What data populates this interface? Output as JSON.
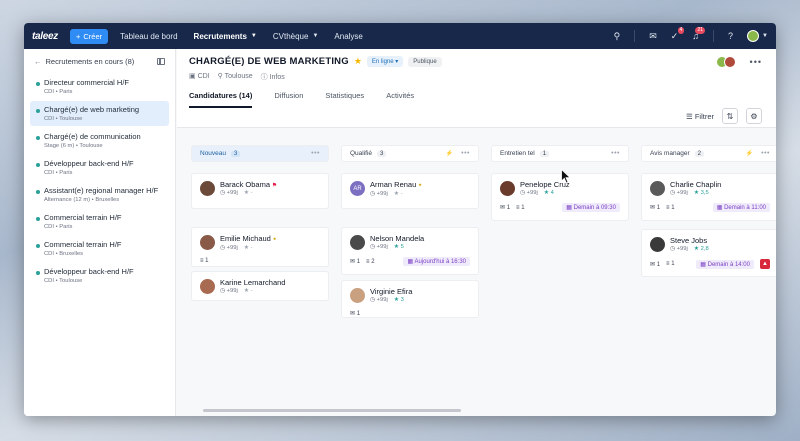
{
  "nav": {
    "logo": "taleez",
    "create": "Créer",
    "items": [
      {
        "label": "Tableau de bord",
        "active": false,
        "caret": false
      },
      {
        "label": "Recrutements",
        "active": true,
        "caret": true
      },
      {
        "label": "CVthèque",
        "active": false,
        "caret": true
      },
      {
        "label": "Analyse",
        "active": false,
        "caret": false
      }
    ],
    "badges": {
      "tasks": "4",
      "notifications": "21"
    }
  },
  "sidebar": {
    "title": "Recrutements en cours (8)",
    "jobs": [
      {
        "title": "Directeur commercial H/F",
        "meta": "CDI • Paris",
        "active": false
      },
      {
        "title": "Chargé(e) de web marketing",
        "meta": "CDI • Toulouse",
        "active": true
      },
      {
        "title": "Chargé(e) de communication",
        "meta": "Stage (6 m) • Toulouse",
        "active": false
      },
      {
        "title": "Développeur back-end H/F",
        "meta": "CDI • Paris",
        "active": false
      },
      {
        "title": "Assistant(e) regional manager H/F",
        "meta": "Alternance (12 m) • Bruxelles",
        "active": false
      },
      {
        "title": "Commercial terrain H/F",
        "meta": "CDI • Paris",
        "active": false
      },
      {
        "title": "Commercial terrain H/F",
        "meta": "CDI • Bruxelles",
        "active": false
      },
      {
        "title": "Développeur back-end H/F",
        "meta": "CDI • Toulouse",
        "active": false
      }
    ]
  },
  "header": {
    "title": "CHARGÉ(E) DE WEB MARKETING",
    "status": "En ligne",
    "visibility": "Publique",
    "contract": "CDI",
    "location": "Toulouse",
    "info": "Infos",
    "tabs": [
      "Candidatures (14)",
      "Diffusion",
      "Statistiques",
      "Activités"
    ],
    "filter": "Filtrer"
  },
  "columns": [
    {
      "name": "Nouveau",
      "count": "3",
      "highlight": true,
      "bolt": false,
      "cards": [
        {
          "name": "Barack Obama",
          "age": "+99j",
          "rating": "-",
          "rated": false,
          "flag": true,
          "medal": false,
          "photo": "#6b4a3a",
          "initials": "",
          "foot": {
            "mail": "",
            "chat": "",
            "sched": "",
            "alarm": false
          }
        },
        {
          "name": "Emilie Michaud",
          "age": "+99j",
          "rating": "-",
          "rated": false,
          "flag": false,
          "medal": true,
          "photo": "#8a5a48",
          "initials": "",
          "foot": {
            "mail": "",
            "chat": "1",
            "sched": "",
            "alarm": false
          }
        },
        {
          "name": "Karine Lemarchand",
          "age": "+99j",
          "rating": "-",
          "rated": false,
          "flag": false,
          "medal": false,
          "photo": "#a86a50",
          "initials": "",
          "foot": {
            "mail": "",
            "chat": "",
            "sched": "",
            "alarm": false
          }
        }
      ]
    },
    {
      "name": "Qualifié",
      "count": "3",
      "highlight": false,
      "bolt": true,
      "cards": [
        {
          "name": "Arman Renau",
          "age": "+99j",
          "rating": "-",
          "rated": false,
          "flag": false,
          "medal": true,
          "photo": "",
          "initials": "AR",
          "foot": {
            "mail": "",
            "chat": "",
            "sched": "",
            "alarm": false
          }
        },
        {
          "name": "Nelson Mandela",
          "age": "+99j",
          "rating": "5",
          "rated": true,
          "flag": false,
          "medal": false,
          "photo": "#4a4a4a",
          "initials": "",
          "foot": {
            "mail": "1",
            "chat": "2",
            "sched": "Aujourd'hui à 16:30",
            "alarm": false
          }
        },
        {
          "name": "Virginie Efira",
          "age": "+99j",
          "rating": "3",
          "rated": true,
          "flag": false,
          "medal": false,
          "photo": "#c9a080",
          "initials": "",
          "foot": {
            "mail": "1",
            "chat": "",
            "sched": "",
            "alarm": false
          }
        }
      ]
    },
    {
      "name": "Entretien tel",
      "count": "1",
      "highlight": false,
      "bolt": false,
      "cards": [
        {
          "name": "Penelope Cruz",
          "age": "+99j",
          "rating": "4",
          "rated": true,
          "flag": false,
          "medal": false,
          "photo": "#6a3a2a",
          "initials": "",
          "foot": {
            "mail": "1",
            "chat": "1",
            "sched": "Demain à 09:30",
            "alarm": false
          }
        }
      ]
    },
    {
      "name": "Avis manager",
      "count": "2",
      "highlight": false,
      "bolt": true,
      "cards": [
        {
          "name": "Charlie Chaplin",
          "age": "+99j",
          "rating": "3,5",
          "rated": true,
          "flag": false,
          "medal": false,
          "photo": "#5a5a5a",
          "initials": "",
          "foot": {
            "mail": "1",
            "chat": "1",
            "sched": "Demain à 11:00",
            "alarm": false
          }
        },
        {
          "name": "Steve Jobs",
          "age": "+99j",
          "rating": "2,8",
          "rated": true,
          "flag": false,
          "medal": false,
          "photo": "#3a3a3a",
          "initials": "",
          "foot": {
            "mail": "1",
            "chat": "1",
            "sched": "Demain à 14:00",
            "alarm": true
          }
        }
      ]
    }
  ]
}
